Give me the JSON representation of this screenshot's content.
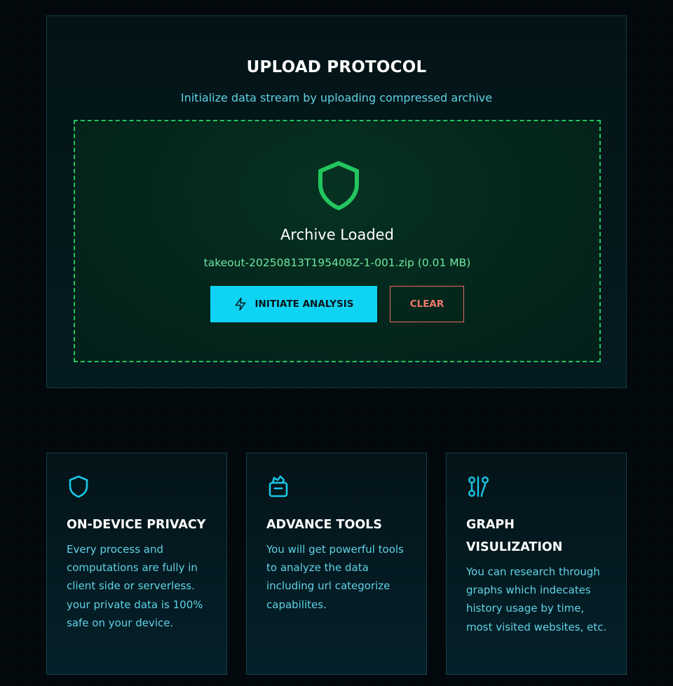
{
  "upload": {
    "title": "UPLOAD PROTOCOL",
    "subtitle": "Initialize data stream by uploading compressed archive",
    "dropzone": {
      "icon": "shield-icon",
      "status": "Archive Loaded",
      "file_info": "takeout-20250813T195408Z-1-001.zip (0.01 MB)",
      "analyze_label": "INITIATE ANALYSIS",
      "analyze_icon": "lightning-icon",
      "clear_label": "CLEAR"
    }
  },
  "features": [
    {
      "icon": "shield-icon",
      "title": "ON-DEVICE PRIVACY",
      "text": "Every process and computations are fully in client side or serverless. your private data is 100% safe on your device."
    },
    {
      "icon": "toolbox-icon",
      "title": "ADVANCE TOOLS",
      "text": "You will get powerful tools to analyze the data including url categorize capabilites."
    },
    {
      "icon": "graph-icon",
      "title": "GRAPH VISULIZATION",
      "text": "You can research through graphs which indecates history usage by time, most visited websites, etc."
    }
  ],
  "colors": {
    "accent_cyan": "#0fd3f2",
    "success_green": "#22c55e",
    "danger_red": "#f0786a",
    "background": "#02080b"
  }
}
